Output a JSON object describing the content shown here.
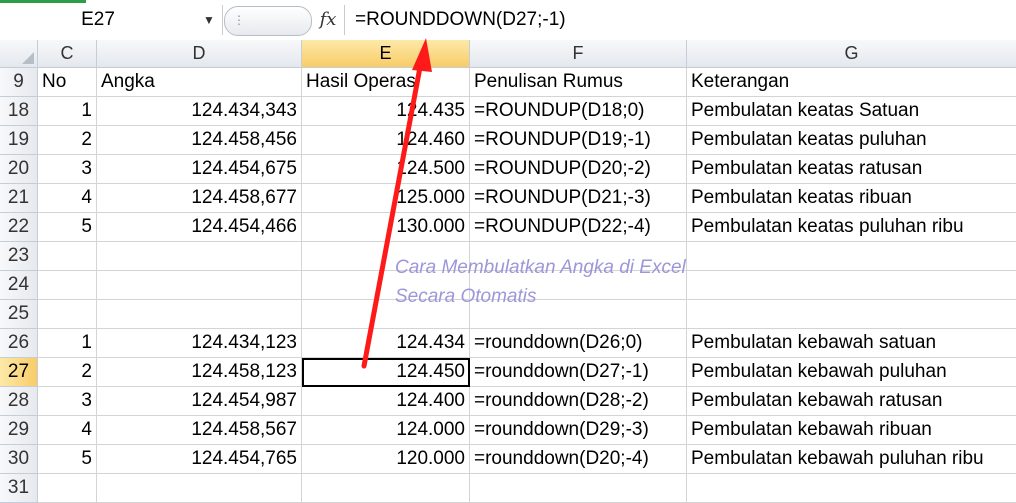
{
  "name_box": "E27",
  "formula_bar": "=ROUNDDOWN(D27;-1)",
  "columns": [
    "C",
    "D",
    "E",
    "F",
    "G"
  ],
  "header_row": {
    "row": "9",
    "C": "No",
    "D": "Angka",
    "E": "Hasil Operasi",
    "F": "Penulisan Rumus",
    "G": "Keterangan"
  },
  "rows": [
    {
      "row": "18",
      "C": "1",
      "D": "124.434,343",
      "E": "124.435",
      "F": "=ROUNDUP(D18;0)",
      "G": "Pembulatan keatas Satuan"
    },
    {
      "row": "19",
      "C": "2",
      "D": "124.458,456",
      "E": "124.460",
      "F": "=ROUNDUP(D19;-1)",
      "G": "Pembulatan keatas puluhan"
    },
    {
      "row": "20",
      "C": "3",
      "D": "124.454,675",
      "E": "124.500",
      "F": "=ROUNDUP(D20;-2)",
      "G": "Pembulatan keatas ratusan"
    },
    {
      "row": "21",
      "C": "4",
      "D": "124.458,677",
      "E": "125.000",
      "F": "=ROUNDUP(D21;-3)",
      "G": "Pembulatan keatas ribuan"
    },
    {
      "row": "22",
      "C": "5",
      "D": "124.454,466",
      "E": "130.000",
      "F": "=ROUNDUP(D22;-4)",
      "G": "Pembulatan keatas puluhan ribu"
    },
    {
      "row": "23",
      "C": "",
      "D": "",
      "E": "",
      "F": "",
      "G": ""
    },
    {
      "row": "24",
      "C": "",
      "D": "",
      "E": "",
      "F": "",
      "G": ""
    },
    {
      "row": "25",
      "C": "",
      "D": "",
      "E": "",
      "F": "",
      "G": ""
    },
    {
      "row": "26",
      "C": "1",
      "D": "124.434,123",
      "E": "124.434",
      "F": "=rounddown(D26;0)",
      "G": "Pembulatan kebawah satuan"
    },
    {
      "row": "27",
      "C": "2",
      "D": "124.458,123",
      "E": "124.450",
      "F": "=rounddown(D27;-1)",
      "G": "Pembulatan kebawah puluhan"
    },
    {
      "row": "28",
      "C": "3",
      "D": "124.454,987",
      "E": "124.400",
      "F": "=rounddown(D28;-2)",
      "G": "Pembulatan kebawah ratusan"
    },
    {
      "row": "29",
      "C": "4",
      "D": "124.458,567",
      "E": "124.000",
      "F": "=rounddown(D29;-3)",
      "G": "Pembulatan kebawah ribuan"
    },
    {
      "row": "30",
      "C": "5",
      "D": "124.454,765",
      "E": "120.000",
      "F": "=rounddown(D20;-4)",
      "G": "Pembulatan kebawah puluhan ribu"
    },
    {
      "row": "31",
      "C": "",
      "D": "",
      "E": "",
      "F": "",
      "G": ""
    }
  ],
  "watermark": {
    "line1": "Cara Membulatkan Angka di Excel",
    "line2": "Secara Otomatis"
  },
  "selected": {
    "row": "27",
    "column": "E"
  },
  "colors": {
    "arrow": "#ff1a1a",
    "watermark": "#9d96d8",
    "selected_header": "#f8cc67",
    "grid": "#d4d4d4"
  }
}
